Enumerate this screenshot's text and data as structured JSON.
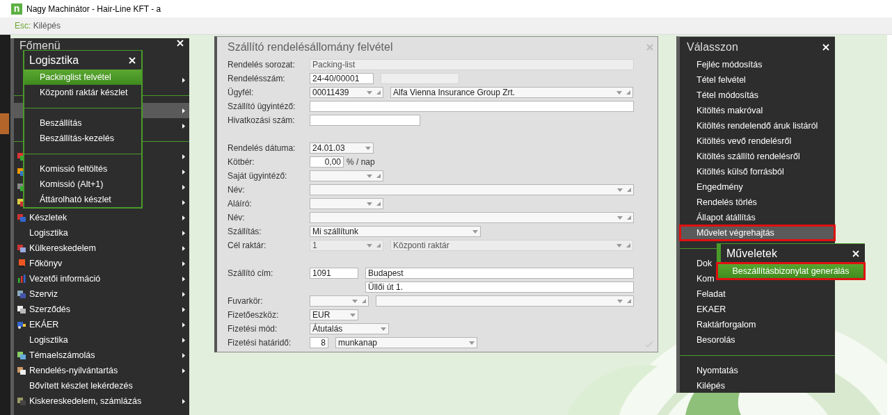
{
  "window": {
    "logo": "n",
    "title": "Nagy Machinátor - Hair-Line KFT - a"
  },
  "toolbar": {
    "key": "Esc:",
    "label": "Kilépés"
  },
  "main_menu": {
    "title": "Főmenü",
    "items": [
      {
        "kind": "item",
        "arrow": true,
        "selected": false
      },
      {
        "kind": "divider"
      },
      {
        "kind": "item",
        "arrow": true,
        "selected": true
      },
      {
        "kind": "item",
        "arrow": true,
        "selected": false
      },
      {
        "kind": "divider"
      },
      {
        "kind": "item",
        "arrow": true,
        "selected": false
      },
      {
        "kind": "item",
        "arrow": true,
        "selected": false
      },
      {
        "kind": "item",
        "arrow": true,
        "selected": false
      },
      {
        "kind": "item",
        "arrow": true,
        "selected": false
      },
      {
        "kind": "item",
        "label": "Készletek",
        "arrow": true,
        "selected": false
      },
      {
        "kind": "item",
        "label": "Logisztika",
        "arrow": true,
        "selected": false
      },
      {
        "kind": "item",
        "label": "Külkereskedelem",
        "arrow": true,
        "selected": false
      },
      {
        "kind": "item",
        "label": "Főkönyv",
        "arrow": true,
        "selected": false
      },
      {
        "kind": "item",
        "label": "Vezetői információ",
        "arrow": true,
        "selected": false
      },
      {
        "kind": "item",
        "label": "Szerviz",
        "arrow": true,
        "selected": false
      },
      {
        "kind": "item",
        "label": "Szerződés",
        "arrow": true,
        "selected": false
      },
      {
        "kind": "item",
        "label": "EKÁER",
        "arrow": true,
        "selected": false
      },
      {
        "kind": "item",
        "label": "Logisztika",
        "arrow": true,
        "selected": false
      },
      {
        "kind": "item",
        "label": "Témaelszámolás",
        "arrow": true,
        "selected": false
      },
      {
        "kind": "item",
        "label": "Rendelés-nyilvántartás",
        "arrow": true,
        "selected": false
      },
      {
        "kind": "item",
        "label": "Bővített készlet lekérdezés",
        "arrow": false,
        "selected": false
      },
      {
        "kind": "item",
        "label": "Kiskereskedelem, számlázás",
        "arrow": true,
        "selected": false
      }
    ]
  },
  "submenu": {
    "title": "Logisztika",
    "items": [
      {
        "kind": "item",
        "label": "Packinglist felvétel",
        "selected": true
      },
      {
        "kind": "item",
        "label": "Központi raktár készlet",
        "selected": false
      },
      {
        "kind": "divider"
      },
      {
        "kind": "item",
        "label": "Beszállítás",
        "selected": false
      },
      {
        "kind": "item",
        "label": "Beszállítás-kezelés",
        "selected": false
      },
      {
        "kind": "divider"
      },
      {
        "kind": "item",
        "label": "Komissió feltöltés",
        "selected": false
      },
      {
        "kind": "item",
        "label": "Komissió (Alt+1)",
        "selected": false
      },
      {
        "kind": "item",
        "label": "Áttárolható készlet",
        "selected": false
      }
    ]
  },
  "dialog": {
    "title": "Szállító rendelésállomány felvétel",
    "rows": [
      {
        "label": "Rendelés sorozat:",
        "fields": [
          {
            "kind": "text",
            "value": "Packing-list",
            "disabled": true
          }
        ]
      },
      {
        "label": "Rendelésszám:",
        "fields": [
          {
            "kind": "text",
            "value": "24-40/00001",
            "disabled": false
          },
          {
            "kind": "text",
            "disabled": true
          }
        ]
      },
      {
        "label": "Ügyfél:",
        "fields": [
          {
            "kind": "lookup",
            "value": "00011439",
            "disabled": false
          },
          {
            "kind": "lookup",
            "value": "Alfa Vienna Insurance Group Zrt.",
            "disabled": false
          }
        ]
      },
      {
        "label": "Szállító ügyintéző:",
        "fields": [
          {
            "kind": "text",
            "disabled": false
          }
        ]
      },
      {
        "label": "Hivatkozási szám:",
        "fields": [
          {
            "kind": "text",
            "disabled": false
          }
        ]
      },
      {
        "label": "Rendelés dátuma:",
        "fields": [
          {
            "kind": "dropdown",
            "value": "24.01.03",
            "disabled": false
          }
        ]
      },
      {
        "label": "Kötbér:",
        "fields": [
          {
            "kind": "number",
            "value": "0,00",
            "disabled": false
          },
          {
            "kind": "suffix",
            "value": "% / nap"
          }
        ]
      },
      {
        "label": "Saját ügyintéző:",
        "fields": [
          {
            "kind": "lookup",
            "disabled": false
          }
        ]
      },
      {
        "label": "Név:",
        "fields": [
          {
            "kind": "lookup",
            "disabled": false
          }
        ]
      },
      {
        "label": "Aláíró:",
        "fields": [
          {
            "kind": "lookup",
            "disabled": false
          }
        ]
      },
      {
        "label": "Név:",
        "fields": [
          {
            "kind": "lookup",
            "disabled": false
          }
        ]
      },
      {
        "label": "Szállítás:",
        "fields": [
          {
            "kind": "dropdown",
            "value": "Mi szállítunk",
            "disabled": false
          }
        ]
      },
      {
        "label": "Cél raktár:",
        "fields": [
          {
            "kind": "lookup",
            "value": "1",
            "disabled": true
          },
          {
            "kind": "lookup",
            "value": "Központi raktár",
            "disabled": true
          }
        ]
      },
      {
        "label": "Szállító cím:",
        "fields": [
          {
            "kind": "text",
            "value": "1091",
            "disabled": false
          },
          {
            "kind": "text",
            "value": "Budapest",
            "disabled": false
          }
        ]
      },
      {
        "fields": [
          {
            "kind": "text",
            "value": "Üllői út 1.",
            "disabled": false
          }
        ]
      },
      {
        "label": "Fuvarkör:",
        "fields": [
          {
            "kind": "lookup",
            "disabled": false
          },
          {
            "kind": "lookup",
            "disabled": false
          }
        ]
      },
      {
        "label": "Fizetőeszköz:",
        "fields": [
          {
            "kind": "dropdown",
            "value": "EUR",
            "disabled": false
          }
        ]
      },
      {
        "label": "Fizetési mód:",
        "fields": [
          {
            "kind": "dropdown",
            "value": "Átutalás",
            "disabled": false
          }
        ]
      },
      {
        "label": "Fizetési határidő:",
        "fields": [
          {
            "kind": "number",
            "value": "8",
            "disabled": false
          },
          {
            "kind": "dropdown",
            "value": "munkanap",
            "disabled": false
          }
        ]
      }
    ]
  },
  "choose_panel": {
    "title": "Válasszon",
    "items": [
      {
        "kind": "item",
        "label": "Fejléc módosítás",
        "selected": false,
        "highlighted": false
      },
      {
        "kind": "item",
        "label": "Tétel felvétel",
        "selected": false,
        "highlighted": false
      },
      {
        "kind": "item",
        "label": "Tétel módosítás",
        "selected": false,
        "highlighted": false
      },
      {
        "kind": "item",
        "label": "Kitöltés makróval",
        "selected": false,
        "highlighted": false
      },
      {
        "kind": "item",
        "label": "Kitöltés rendelendő áruk listáról",
        "selected": false,
        "highlighted": false
      },
      {
        "kind": "item",
        "label": "Kitöltés vevő rendelésről",
        "selected": false,
        "highlighted": false
      },
      {
        "kind": "item",
        "label": "Kitöltés szállító rendelésről",
        "selected": false,
        "highlighted": false
      },
      {
        "kind": "item",
        "label": "Kitöltés külső forrásból",
        "selected": false,
        "highlighted": false
      },
      {
        "kind": "item",
        "label": "Engedmény",
        "selected": false,
        "highlighted": false
      },
      {
        "kind": "item",
        "label": "Rendelés törlés",
        "selected": false,
        "highlighted": false
      },
      {
        "kind": "item",
        "label": "Állapot átállítás",
        "selected": false,
        "highlighted": false
      },
      {
        "kind": "item",
        "label": "Művelet végrehajtás",
        "selected": true,
        "highlighted": true
      },
      {
        "kind": "divider"
      },
      {
        "kind": "item",
        "label": "Dok",
        "selected": false,
        "highlighted": false
      },
      {
        "kind": "item",
        "label": "Kom",
        "selected": false,
        "highlighted": false
      },
      {
        "kind": "item",
        "label": "Feladat",
        "selected": false,
        "highlighted": false
      },
      {
        "kind": "item",
        "label": "EKAER",
        "selected": false,
        "highlighted": false
      },
      {
        "kind": "item",
        "label": "Raktárforgalom",
        "selected": false,
        "highlighted": false
      },
      {
        "kind": "item",
        "label": "Besorolás",
        "selected": false,
        "highlighted": false
      },
      {
        "kind": "divider"
      },
      {
        "kind": "item",
        "label": "Nyomtatás",
        "selected": false,
        "highlighted": false
      },
      {
        "kind": "item",
        "label": "Kilépés",
        "selected": false,
        "highlighted": false
      }
    ]
  },
  "actions_popup": {
    "title": "Műveletek",
    "items": [
      {
        "label": "Beszállításbizonylat generálás",
        "selected": true,
        "highlighted": true
      }
    ]
  }
}
